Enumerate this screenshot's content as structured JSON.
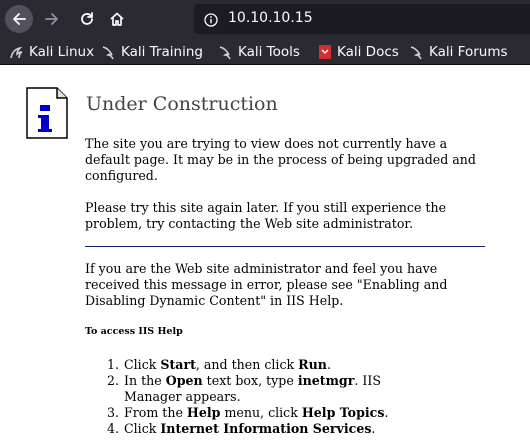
{
  "browser": {
    "url": "10.10.10.15",
    "bookmarks": [
      {
        "label": "Kali Linux",
        "icon": "kali-dragon-icon"
      },
      {
        "label": "Kali Training",
        "icon": "kali-dragon-icon"
      },
      {
        "label": "Kali Tools",
        "icon": "kali-dragon-icon"
      },
      {
        "label": "Kali Docs",
        "icon": "kali-docs-icon"
      },
      {
        "label": "Kali Forums",
        "icon": "kali-dragon-icon"
      }
    ]
  },
  "page": {
    "heading": "Under Construction",
    "para1": "The site you are trying to view does not currently have a default page. It may be in the process of being upgraded and configured.",
    "para2": "Please try this site again later. If you still experience the problem, try contacting the Web site administrator.",
    "para3": "If you are the Web site administrator and feel you have received this message in error, please see \"Enabling and Disabling Dynamic Content\" in IIS Help.",
    "help_title": "To access IIS Help",
    "steps": [
      {
        "num": "1.",
        "parts": [
          "Click ",
          "Start",
          ", and then click ",
          "Run",
          "."
        ]
      },
      {
        "num": "2.",
        "parts": [
          "In the ",
          "Open",
          " text box, type ",
          "inetmgr",
          ". IIS Manager appears."
        ]
      },
      {
        "num": "3.",
        "parts": [
          "From the ",
          "Help",
          " menu, click ",
          "Help Topics",
          "."
        ]
      },
      {
        "num": "4.",
        "parts": [
          "Click ",
          "Internet Information Services",
          "."
        ]
      }
    ]
  },
  "colors": {
    "chrome": "#2b2a33",
    "urlbar": "#1c1b22",
    "rule": "#0e1a6a",
    "icon_blue": "#0000cc"
  }
}
